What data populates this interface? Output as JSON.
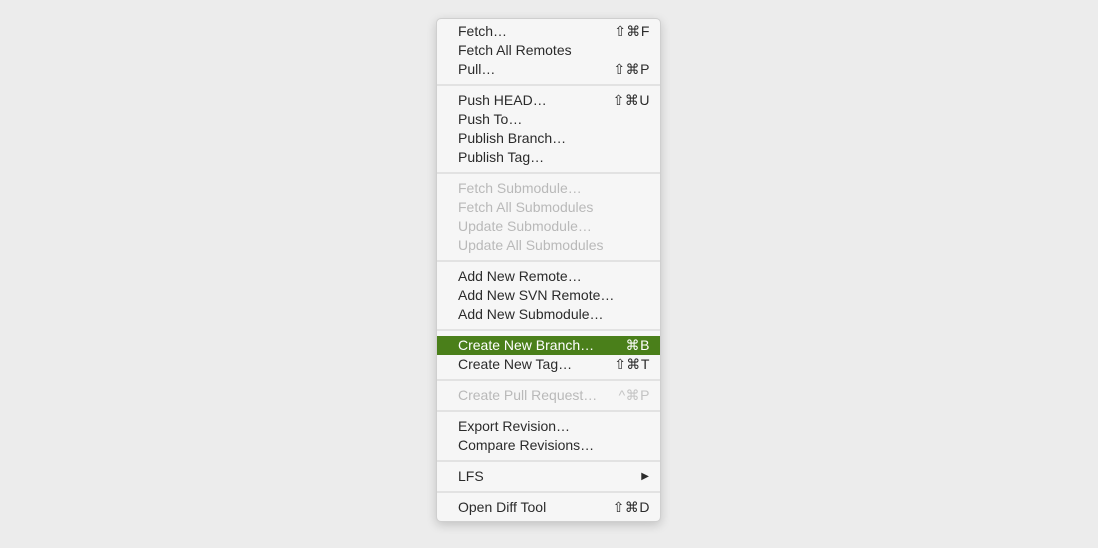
{
  "menu": {
    "highlight_color": "#4a7f1a",
    "groups": [
      [
        {
          "label": "Fetch…",
          "shortcut": "⇧⌘F",
          "enabled": true
        },
        {
          "label": "Fetch All Remotes",
          "shortcut": "",
          "enabled": true
        },
        {
          "label": "Pull…",
          "shortcut": "⇧⌘P",
          "enabled": true
        }
      ],
      [
        {
          "label": "Push HEAD…",
          "shortcut": "⇧⌘U",
          "enabled": true
        },
        {
          "label": "Push To…",
          "shortcut": "",
          "enabled": true
        },
        {
          "label": "Publish Branch…",
          "shortcut": "",
          "enabled": true
        },
        {
          "label": "Publish Tag…",
          "shortcut": "",
          "enabled": true
        }
      ],
      [
        {
          "label": "Fetch Submodule…",
          "shortcut": "",
          "enabled": false
        },
        {
          "label": "Fetch All Submodules",
          "shortcut": "",
          "enabled": false
        },
        {
          "label": "Update Submodule…",
          "shortcut": "",
          "enabled": false
        },
        {
          "label": "Update All Submodules",
          "shortcut": "",
          "enabled": false
        }
      ],
      [
        {
          "label": "Add New Remote…",
          "shortcut": "",
          "enabled": true
        },
        {
          "label": "Add New SVN Remote…",
          "shortcut": "",
          "enabled": true
        },
        {
          "label": "Add New Submodule…",
          "shortcut": "",
          "enabled": true
        }
      ],
      [
        {
          "label": "Create New Branch…",
          "shortcut": "⌘B",
          "enabled": true,
          "highlighted": true
        },
        {
          "label": "Create New Tag…",
          "shortcut": "⇧⌘T",
          "enabled": true
        }
      ],
      [
        {
          "label": "Create Pull Request…",
          "shortcut": "^⌘P",
          "enabled": false
        }
      ],
      [
        {
          "label": "Export Revision…",
          "shortcut": "",
          "enabled": true
        },
        {
          "label": "Compare Revisions…",
          "shortcut": "",
          "enabled": true
        }
      ],
      [
        {
          "label": "LFS",
          "shortcut": "",
          "enabled": true,
          "submenu": true,
          "submenu_icon": "▶"
        }
      ],
      [
        {
          "label": "Open Diff Tool",
          "shortcut": "⇧⌘D",
          "enabled": true
        }
      ]
    ]
  }
}
